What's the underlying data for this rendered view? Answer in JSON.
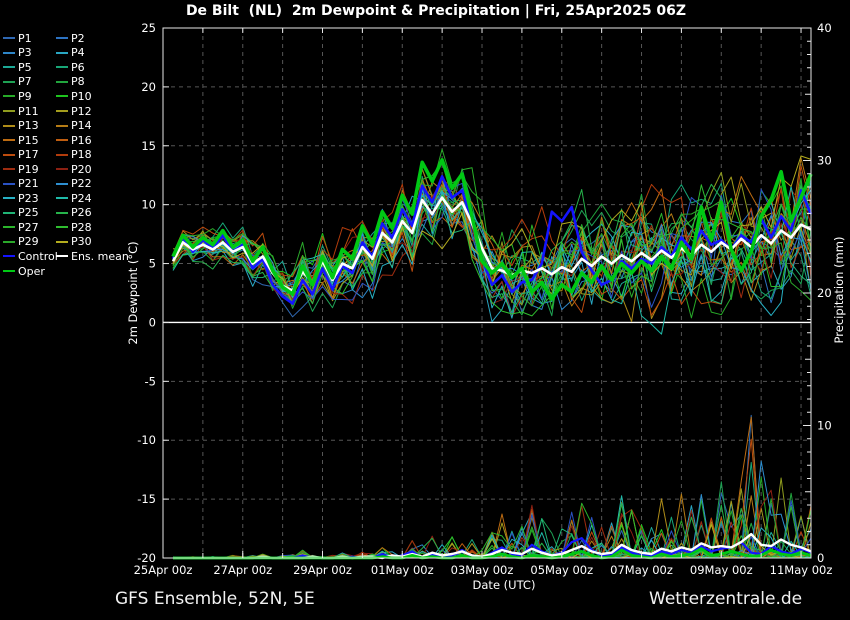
{
  "title": "De Bilt  (NL)  2m Dewpoint & Precipitation | Fri, 25Apr2025 06Z",
  "footer": {
    "left": "GFS Ensemble, 52N, 5E",
    "right": "Wetterzentrale.de"
  },
  "legend": {
    "members": [
      {
        "label": "P1",
        "color": "#2f68b3"
      },
      {
        "label": "P2",
        "color": "#2d73c2"
      },
      {
        "label": "P3",
        "color": "#2e86c8"
      },
      {
        "label": "P4",
        "color": "#29a6c2"
      },
      {
        "label": "P5",
        "color": "#1ca996"
      },
      {
        "label": "P6",
        "color": "#18a677"
      },
      {
        "label": "P7",
        "color": "#1ea254"
      },
      {
        "label": "P8",
        "color": "#21a53d"
      },
      {
        "label": "P9",
        "color": "#27aa28"
      },
      {
        "label": "P10",
        "color": "#1ec41e"
      },
      {
        "label": "P11",
        "color": "#8f9c1e"
      },
      {
        "label": "P12",
        "color": "#a49d1d"
      },
      {
        "label": "P13",
        "color": "#ae8c18"
      },
      {
        "label": "P14",
        "color": "#b67c15"
      },
      {
        "label": "P15",
        "color": "#bd6c12"
      },
      {
        "label": "P16",
        "color": "#c05e10"
      },
      {
        "label": "P17",
        "color": "#bd4c0e"
      },
      {
        "label": "P18",
        "color": "#b23c0c"
      },
      {
        "label": "P19",
        "color": "#9e2c10"
      },
      {
        "label": "P20",
        "color": "#8c2012"
      },
      {
        "label": "P21",
        "color": "#2a52c4"
      },
      {
        "label": "P22",
        "color": "#2e8fd0"
      },
      {
        "label": "P23",
        "color": "#27b0c4"
      },
      {
        "label": "P24",
        "color": "#1fbaa9"
      },
      {
        "label": "P25",
        "color": "#20b576"
      },
      {
        "label": "P26",
        "color": "#26b34b"
      },
      {
        "label": "P27",
        "color": "#2bb42b"
      },
      {
        "label": "P28",
        "color": "#2fbd2f"
      },
      {
        "label": "P29",
        "color": "#2aa82a"
      },
      {
        "label": "P30",
        "color": "#b3ac1e"
      }
    ],
    "special": [
      {
        "label": "Control",
        "color": "#1414ff"
      },
      {
        "label": "Ens. mean",
        "color": "#ffffff"
      },
      {
        "label": "Oper",
        "color": "#00c814"
      }
    ]
  },
  "chart_data": {
    "type": "line",
    "title": "De Bilt  (NL)  2m Dewpoint & Precipitation | Fri, 25Apr2025 06Z",
    "xlabel": "Date (UTC)",
    "ylabel": "2m Dewpoint (°C)",
    "ylabel_right": "Precipitation (mm)",
    "x_tick_labels": [
      "25Apr 00z",
      "27Apr 00z",
      "29Apr 00z",
      "01May 00z",
      "03May 00z",
      "05May 00z",
      "07May 00z",
      "09May 00z",
      "11May 00z"
    ],
    "x_tick_hours": [
      0,
      48,
      96,
      144,
      192,
      240,
      288,
      336,
      384
    ],
    "x_range_hours": [
      0,
      390
    ],
    "x_grid_interval_hours": 24,
    "ylim": [
      -20,
      25
    ],
    "y_ticks": [
      -20,
      -15,
      -10,
      -5,
      0,
      5,
      10,
      15,
      20,
      25
    ],
    "ylim_right": [
      0,
      40
    ],
    "y_ticks_right": [
      0,
      10,
      20,
      30,
      40
    ],
    "zero_line": 0,
    "step_hours": 6,
    "first_point_hour": 6,
    "legend_position": "outside-left",
    "grid": "dashed",
    "series": {
      "ens_mean_dewpoint": [
        5.2,
        6.8,
        6.2,
        6.6,
        6.2,
        6.8,
        6.0,
        6.4,
        5.0,
        5.6,
        4.2,
        3.1,
        2.7,
        4.3,
        3.4,
        5.2,
        3.6,
        5.0,
        4.6,
        6.4,
        5.4,
        7.6,
        6.8,
        8.6,
        7.6,
        10.4,
        9.2,
        10.6,
        9.4,
        10.2,
        8.4,
        6.3,
        4.6,
        4.4,
        4.0,
        4.4,
        4.2,
        4.6,
        4.1,
        4.7,
        4.3,
        5.4,
        4.8,
        5.6,
        5.0,
        5.7,
        5.2,
        5.9,
        5.3,
        6.1,
        5.5,
        6.3,
        5.7,
        6.6,
        6.0,
        6.8,
        6.2,
        7.1,
        6.4,
        7.4,
        6.7,
        7.8,
        7.2,
        8.3,
        7.9
      ],
      "control_dewpoint": [
        5.4,
        7.2,
        6.0,
        7.0,
        6.3,
        7.4,
        6.0,
        6.6,
        4.6,
        5.4,
        3.2,
        2.2,
        1.6,
        3.6,
        2.4,
        4.6,
        2.8,
        4.8,
        4.2,
        6.8,
        5.6,
        8.4,
        7.2,
        9.6,
        8.2,
        11.6,
        10.2,
        12.4,
        10.6,
        11.2,
        8.6,
        5.4,
        3.2,
        4.0,
        2.6,
        3.4,
        3.6,
        5.0,
        9.4,
        8.6,
        9.8,
        6.0,
        4.4,
        3.2,
        3.6,
        5.2,
        4.6,
        5.4,
        5.0,
        6.4,
        5.6,
        7.2,
        6.2,
        7.8,
        6.6,
        7.0,
        6.2,
        7.4,
        6.8,
        8.8,
        7.2,
        9.0,
        7.8,
        11.2,
        9.2
      ],
      "oper_dewpoint": [
        5.6,
        7.4,
        6.4,
        7.2,
        6.6,
        7.8,
        6.4,
        7.0,
        5.2,
        6.4,
        4.4,
        3.0,
        2.4,
        4.8,
        3.2,
        5.6,
        3.8,
        6.2,
        5.4,
        8.2,
        6.6,
        9.4,
        8.0,
        10.8,
        9.2,
        13.6,
        12.0,
        13.8,
        11.4,
        12.6,
        9.0,
        5.2,
        4.2,
        5.0,
        3.8,
        4.6,
        2.6,
        3.4,
        2.0,
        3.2,
        2.6,
        4.2,
        3.4,
        4.8,
        3.6,
        5.0,
        4.2,
        5.2,
        4.4,
        5.6,
        4.6,
        6.8,
        5.4,
        9.8,
        7.0,
        10.2,
        6.2,
        4.4,
        6.0,
        9.0,
        10.4,
        12.8,
        8.6,
        10.6,
        12.6
      ],
      "ensemble_spread": [
        1.0,
        1.1,
        1.1,
        1.2,
        1.2,
        1.3,
        1.3,
        1.4,
        1.6,
        1.7,
        1.8,
        1.9,
        2.0,
        2.0,
        2.1,
        2.1,
        2.2,
        2.2,
        2.3,
        2.3,
        2.4,
        2.4,
        2.5,
        2.5,
        2.6,
        2.6,
        2.7,
        2.7,
        2.8,
        2.9,
        3.0,
        3.1,
        3.2,
        3.2,
        3.3,
        3.3,
        3.4,
        3.4,
        3.5,
        3.5,
        3.6,
        3.6,
        3.7,
        3.7,
        3.8,
        3.8,
        3.9,
        3.9,
        4.0,
        4.0,
        4.1,
        4.1,
        4.2,
        4.3,
        4.3,
        4.4,
        4.4,
        4.5,
        4.5,
        4.6,
        4.6,
        4.7,
        4.7,
        4.8,
        4.8
      ],
      "ens_mean_precip": [
        0,
        0,
        0,
        0,
        0,
        0,
        0,
        0,
        0,
        0.1,
        0,
        0,
        0,
        0,
        0.1,
        0,
        0,
        0.1,
        0,
        0.1,
        0.1,
        0,
        0.2,
        0.1,
        0.3,
        0.1,
        0.4,
        0.2,
        0.3,
        0.5,
        0.2,
        0.1,
        0.3,
        0.6,
        0.4,
        0.3,
        0.7,
        0.4,
        0.2,
        0.3,
        0.6,
        0.9,
        0.5,
        0.3,
        0.4,
        1.0,
        0.6,
        0.4,
        0.3,
        0.7,
        0.5,
        0.8,
        0.6,
        1.1,
        0.8,
        0.9,
        0.8,
        1.2,
        1.8,
        1.0,
        0.9,
        1.4,
        1.0,
        0.8,
        0.5
      ],
      "control_precip": [
        0,
        0,
        0,
        0,
        0,
        0,
        0,
        0,
        0,
        0,
        0,
        0,
        0,
        0.2,
        0,
        0,
        0,
        0,
        0.1,
        0,
        0,
        0.3,
        0,
        0.2,
        0.5,
        0,
        0.3,
        0,
        0.2,
        0.6,
        0.1,
        0,
        0.4,
        0.8,
        0.3,
        0.2,
        1.0,
        0.5,
        0.2,
        0.4,
        1.2,
        1.5,
        0.6,
        0.2,
        0.3,
        0.8,
        0.4,
        0.2,
        0.2,
        0.5,
        0.3,
        0.6,
        0.4,
        0.9,
        0.5,
        0.7,
        0.8,
        1.2,
        0.4,
        0.3,
        0.9,
        0.5,
        0.3,
        0.7,
        0.4
      ],
      "oper_precip": [
        0,
        0,
        0,
        0,
        0,
        0,
        0,
        0,
        0,
        0,
        0,
        0,
        0,
        0,
        0,
        0,
        0,
        0,
        0,
        0,
        0,
        0.1,
        0,
        0,
        0.2,
        0,
        0.1,
        0,
        0,
        0.2,
        0,
        0,
        0.1,
        0.3,
        0.1,
        0,
        0.2,
        0.1,
        0,
        0.1,
        0.3,
        0.5,
        0.2,
        0,
        0.1,
        0.6,
        0.2,
        0.1,
        0,
        0.3,
        0.1,
        0.2,
        0.3,
        0.7,
        0.2,
        0.3,
        0.5,
        0.3,
        0.1,
        0.2,
        0.6,
        0.3,
        0.2,
        0.4,
        0.2
      ],
      "ensemble_precip_max": [
        0.1,
        0,
        0.1,
        0,
        0.1,
        0,
        0.2,
        0.1,
        0.2,
        0.3,
        0.1,
        0.2,
        0.3,
        0.6,
        0.2,
        0.1,
        0.2,
        0.4,
        0.3,
        0.5,
        0.4,
        0.8,
        0.5,
        0.6,
        1.5,
        1.0,
        2.2,
        1.2,
        1.8,
        2.4,
        1.5,
        1.0,
        2.0,
        3.5,
        2.5,
        3.0,
        4.5,
        3.0,
        2.0,
        2.5,
        4.0,
        5.5,
        3.5,
        2.5,
        3.0,
        6.5,
        4.0,
        3.0,
        2.5,
        4.5,
        3.5,
        5.0,
        4.0,
        7.0,
        5.5,
        6.0,
        5.0,
        6.5,
        13.2,
        7.5,
        5.5,
        8.4,
        5.0,
        6.0,
        4.0
      ]
    },
    "colors": {
      "background": "#000000",
      "grid": "#565656",
      "axis": "#e8e8e8",
      "zero_line": "#ffffff",
      "control": "#1414ff",
      "ens_mean": "#ffffff",
      "oper": "#00c814"
    }
  }
}
